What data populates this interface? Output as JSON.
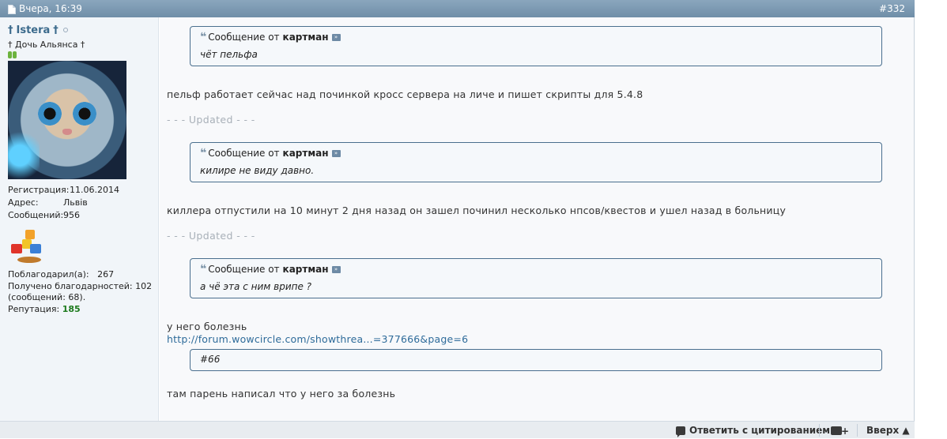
{
  "header": {
    "date": "Вчера, 16:39",
    "post_number": "#332"
  },
  "user": {
    "name": "Istera",
    "name_prefix": "†",
    "name_suffix": "†",
    "title": "† Дочь Альянса †",
    "stats": [
      {
        "label": "Регистрация:",
        "value": "11.06.2014"
      },
      {
        "label": "Адрес:",
        "value": "Львів"
      },
      {
        "label": "Сообщений:",
        "value": "956"
      }
    ],
    "thanked_label": "Поблагодарил(а):",
    "thanked_value": "267",
    "received_line1": "Получено благодарностей: 102",
    "received_line2": "(сообщений: 68).",
    "rep_label": "Репутация:",
    "rep_value": "185"
  },
  "post": {
    "q1": {
      "prefix": "Сообщение от",
      "author": "картман",
      "text": "чёт пельфа"
    },
    "t1": "пельф работает сейчас над починкой кросс сервера на личе и пишет скрипты для 5.4.8",
    "updated": "- - - Updated - - -",
    "q2": {
      "prefix": "Сообщение от",
      "author": "картман",
      "text": "килире не виду давно."
    },
    "t2": "киллера отпустили на 10 минут 2 дня назад он зашел починил несколько нпсов/квестов и ушел назад в больницу",
    "q3": {
      "prefix": "Сообщение от",
      "author": "картман",
      "text": "а чё эта с ним врипе ?"
    },
    "t3": "у него болезнь",
    "link": "http://forum.wowcircle.com/showthrea...=377666&page=6",
    "q4_text": "#66",
    "t4": "там парень написал что у него за болезнь"
  },
  "footer": {
    "reply_quote": "Ответить с цитированием",
    "top": "Вверх ▲"
  }
}
